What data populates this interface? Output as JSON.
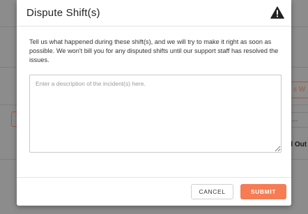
{
  "background": {
    "right_button_text": "s W",
    "select_text": "...",
    "bold_text": "d Out"
  },
  "modal": {
    "title": "Dispute Shift(s)",
    "icon": "warning-triangle-icon",
    "description": "Tell us what happened during these shift(s), and we will try to make it right as soon as possible. We won't bill you for any disputed shifts until our support staff has resolved the issues.",
    "textarea": {
      "value": "",
      "placeholder": "Enter a description of the incident(s) here."
    },
    "cancel_label": "CANCEL",
    "submit_label": "SUBMIT"
  },
  "colors": {
    "accent": "#f57c54",
    "overlay": "#8c8c8c"
  }
}
